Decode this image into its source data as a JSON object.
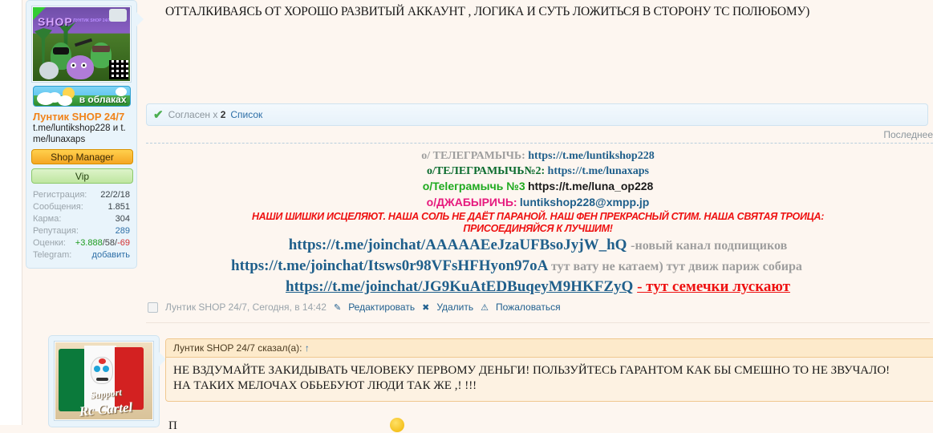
{
  "post1": {
    "user": {
      "avatar": {
        "brand_text": "SHOP",
        "sub_text": "ЛУНТИК SHOP 24/7",
        "badge_text": "в облаках",
        "badge_icon": "clouds-sun-icon",
        "qr_icon": "qr-code-icon"
      },
      "name": "Лунтик SHOP 24/7",
      "tagline": "t.me/luntikshop228 и t.me/lunaxaps",
      "rank_primary": "Shop Manager",
      "rank_secondary": "Vip",
      "stats": [
        {
          "label": "Регистрация:",
          "value": "22/2/18",
          "style": "plain"
        },
        {
          "label": "Сообщения:",
          "value": "1.851",
          "style": "plain"
        },
        {
          "label": "Карма:",
          "value": "304",
          "style": "plain"
        },
        {
          "label": "Репутация:",
          "value": "289",
          "style": "blue"
        },
        {
          "label": "Оценки:",
          "value": "",
          "style": "ratings"
        },
        {
          "label": "Telegram:",
          "value": "добавить",
          "style": "link"
        }
      ],
      "ratings": {
        "positive": "+3.888",
        "neutral": "58",
        "negative": "-69",
        "sep": "/"
      }
    },
    "top_text": "ОТТАЛКИВАЯСЬ ОТ ХОРОШО РАЗВИТЫЙ АККАУНТ , ЛОГИКА И СУТЬ ЛОЖИТЬСЯ В СТОРОНУ ТС ПОЛЮБОМУ)",
    "likebar": {
      "check_icon": "green-check-icon",
      "text_prefix": "Согласен x",
      "count": "2",
      "list_link": "Список"
    },
    "last_label": "Последнее",
    "promo": {
      "line1_label": "o/ ТЕЛЕГРАМЫЧЬ:",
      "line1_url": "https://t.me/luntikshop228",
      "line2_label": "o/ТЕЛЕГРАМЫЧЬ№2:",
      "line2_url": "https://t.me/lunaxaps",
      "line3_label": "o/Teleграмычь №3",
      "line3_url": "https://t.me/luna_op228",
      "line4_label": "o/ДЖАБЫРИЧЬ:",
      "line4_url": "luntikshop228@xmpp.jp",
      "red_line1": "НАШИ ШИШКИ ИСЦЕЛЯЮТ. НАША СОЛЬ НЕ ДАЁТ ПАРАНОЙ. НАШ ФЕН ПРЕКРАСНЫЙ СТИМ. НАША СВЯТАЯ ТРОИЦА:",
      "red_line2": "ПРИСОЕДИНЯЙСЯ К ЛУЧШИМ!",
      "join1_url": "https://t.me/joinchat/AAAAAEeJzaUFBsoJyjW_hQ",
      "join1_note": "-новый канал подпищиков",
      "join2_url": "https://t.me/joinchat/Itsws0r98VFsHFHyon97oA",
      "join2_note": "тут вату не катаем) тут движ париж собира",
      "join3_url": "https://t.me/joinchat/JG9KuAtEDBuqeyM9HKFZyQ",
      "join3_note": "- тут семечки лускают"
    },
    "footer": {
      "meta": "Лунтик SHOP 24/7, Сегодня, в 14:42",
      "edit_label": "Редактировать",
      "edit_icon": "pencil-icon",
      "delete_label": "Удалить",
      "delete_icon": "x-icon",
      "report_label": "Пожаловаться",
      "report_icon": "warning-triangle-icon"
    }
  },
  "post2": {
    "user": {
      "avatar": {
        "title_top": "Support",
        "title_bottom": "Rc Cartel",
        "flag_icon": "mexico-flag-icon",
        "skull_icon": "sugar-skull-icon"
      }
    },
    "quote": {
      "header": "Лунтик SHOP 24/7 сказал(а):",
      "arrow": "↑",
      "body_line1": "НЕ ВЗДУМАЙТЕ ЗАКИДЫВАТЬ ЧЕЛОВЕКУ ПЕРВОМУ ДЕНЬГИ! ПОЛЬЗУЙТЕСЬ ГАРАНТОМ КАК БЫ СМЕШНО ТО НЕ ЗВУЧАЛО!",
      "body_line2": "НА ТАКИХ МЕЛОЧАХ ОБЬЕБУЮТ ЛЮДИ ТАК ЖЕ ,! !!!"
    },
    "after_text": "П",
    "emoji_icon": "smiley-emoji-icon"
  },
  "colors": {
    "username": "#f0831a",
    "link": "#2e6fa7",
    "promo_blue": "#1f5f8b",
    "promo_green": "#1faa1f",
    "promo_dgreen": "#0b6b2e",
    "promo_pink": "#e6197d",
    "promo_red": "#ee1111",
    "gray": "#9e9e9e",
    "page_bg": "#fdf6f0",
    "userbox_bg": "#e9f4fb",
    "quote_bg": "#fdf2e2"
  }
}
